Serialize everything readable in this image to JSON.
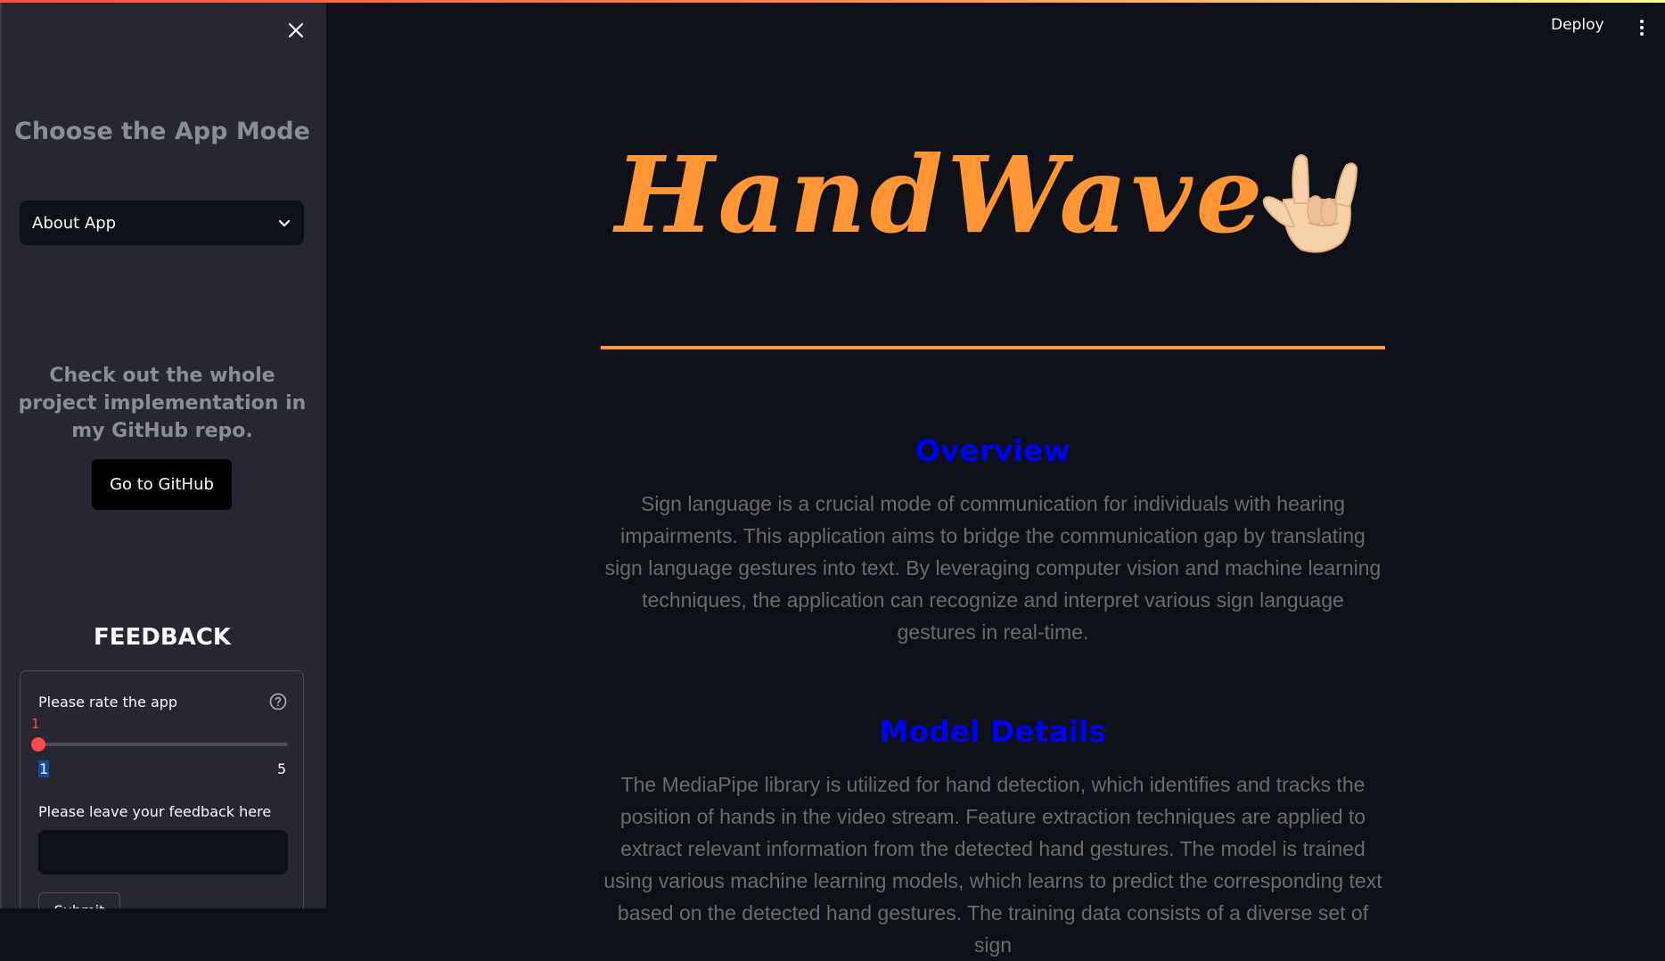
{
  "sidebar": {
    "title": "Choose the App Mode",
    "select": {
      "value": "About App"
    },
    "description": "Check out the whole project implementation in my GitHub repo.",
    "github_button": "Go to GitHub",
    "feedback": {
      "heading": "FEEDBACK",
      "rate_label": "Please rate the app",
      "slider": {
        "value": 1,
        "min": "1",
        "max": "5",
        "current_label": "1"
      },
      "feedback_label": "Please leave your feedback here",
      "feedback_value": "",
      "submit_label": "Submit"
    }
  },
  "header": {
    "deploy_label": "Deploy"
  },
  "main": {
    "title": "HandWave",
    "sections": [
      {
        "heading": "Overview",
        "body": "Sign language is a crucial mode of communication for individuals with hearing impairments. This application aims to bridge the communication gap by translating sign language gestures into text. By leveraging computer vision and machine learning techniques, the application can recognize and interpret various sign language gestures in real-time."
      },
      {
        "heading": "Model Details",
        "body": "The MediaPipe library is utilized for hand detection, which identifies and tracks the position of hands in the video stream. Feature extraction techniques are applied to extract relevant information from the detected hand gestures. The model is trained using various machine learning models, which learns to predict the corresponding text based on the detected hand gestures. The training data consists of a diverse set of sign"
      }
    ]
  },
  "colors": {
    "accent": "#ff9633",
    "heading_blue": "#0000ff",
    "slider_red": "#ff4b4b",
    "background": "#0e1117",
    "sidebar_bg": "#262730"
  },
  "icons": {
    "close": "close-icon",
    "dropdown": "chevron-down-icon",
    "help": "question-circle-icon",
    "menu": "kebab-menu-icon",
    "hand": "love-you-hand-icon"
  }
}
